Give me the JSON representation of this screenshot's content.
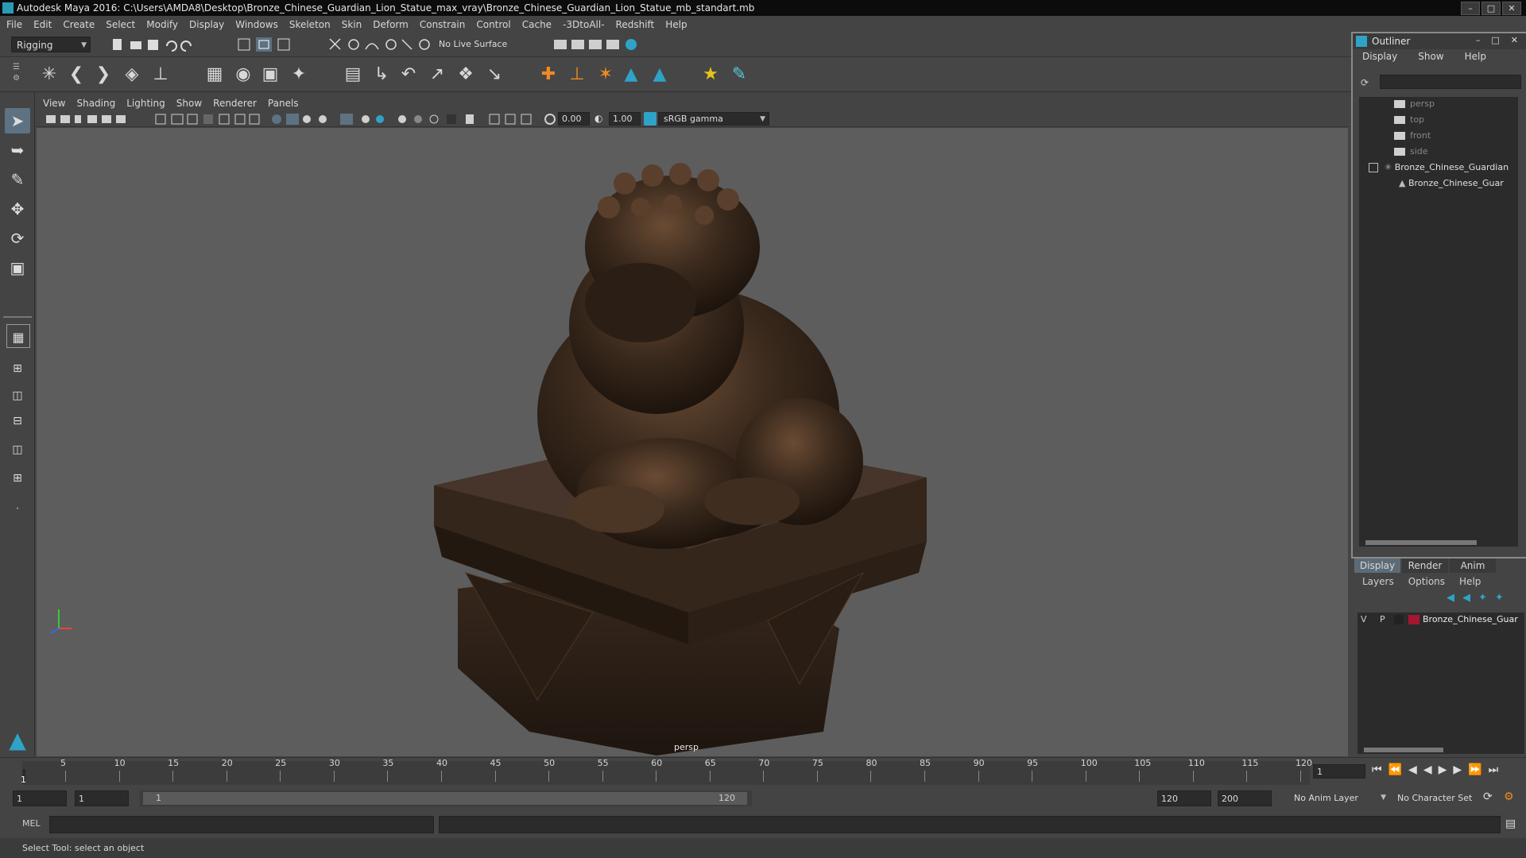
{
  "window": {
    "title": "Autodesk Maya 2016: C:\\Users\\AMDA8\\Desktop\\Bronze_Chinese_Guardian_Lion_Statue_max_vray\\Bronze_Chinese_Guardian_Lion_Statue_mb_standart.mb",
    "buttons": [
      "minimize-icon",
      "maximize-icon",
      "close-icon"
    ]
  },
  "menubar": {
    "items": [
      "File",
      "Edit",
      "Create",
      "Select",
      "Modify",
      "Display",
      "Windows",
      "Skeleton",
      "Skin",
      "Deform",
      "Constrain",
      "Control",
      "Cache",
      "-3DtoAll-",
      "Redshift",
      "Help"
    ]
  },
  "statusline": {
    "mode": "Rigging",
    "live_surface": "No Live Surface"
  },
  "panel": {
    "menu": [
      "View",
      "Shading",
      "Lighting",
      "Show",
      "Renderer",
      "Panels"
    ],
    "exposure": "0.00",
    "gamma": "1.00",
    "colorspace": "sRGB gamma",
    "camera": "persp"
  },
  "outliner": {
    "title": "Outliner",
    "menu": [
      "Display",
      "Show",
      "Help"
    ],
    "items": [
      {
        "label": "persp",
        "dim": true,
        "indent": 0
      },
      {
        "label": "top",
        "dim": true,
        "indent": 0
      },
      {
        "label": "front",
        "dim": true,
        "indent": 0
      },
      {
        "label": "side",
        "dim": true,
        "indent": 0
      },
      {
        "label": "Bronze_Chinese_Guardian",
        "dim": false,
        "indent": 0
      },
      {
        "label": "Bronze_Chinese_Guar",
        "dim": false,
        "indent": 1
      }
    ]
  },
  "layers": {
    "tabs": [
      "Display",
      "Render",
      "Anim"
    ],
    "menu": [
      "Layers",
      "Options",
      "Help"
    ],
    "row": {
      "v": "V",
      "p": "P",
      "name": "Bronze_Chinese_Guar",
      "color": "#a5172f"
    }
  },
  "timeline": {
    "ticks": [
      "5",
      "10",
      "15",
      "20",
      "25",
      "30",
      "35",
      "40",
      "45",
      "50",
      "55",
      "60",
      "65",
      "70",
      "75",
      "80",
      "85",
      "90",
      "95",
      "100",
      "105",
      "110",
      "115",
      "120"
    ],
    "start_marker": "1",
    "current_frame": "1"
  },
  "range": {
    "start": "1",
    "playback_start": "1",
    "slider_start": "1",
    "slider_end": "120",
    "playback_end": "120",
    "end": "200",
    "anim_layer": "No Anim Layer",
    "character_set": "No Character Set"
  },
  "cmdline": {
    "lang": "MEL"
  },
  "helpline": {
    "text": "Select Tool: select an object"
  },
  "colors": {
    "accent": "#5d7282",
    "viewport_bg": "#5d5d5d",
    "bronze": "#3b2a1d",
    "layer_color": "#a5172f"
  }
}
